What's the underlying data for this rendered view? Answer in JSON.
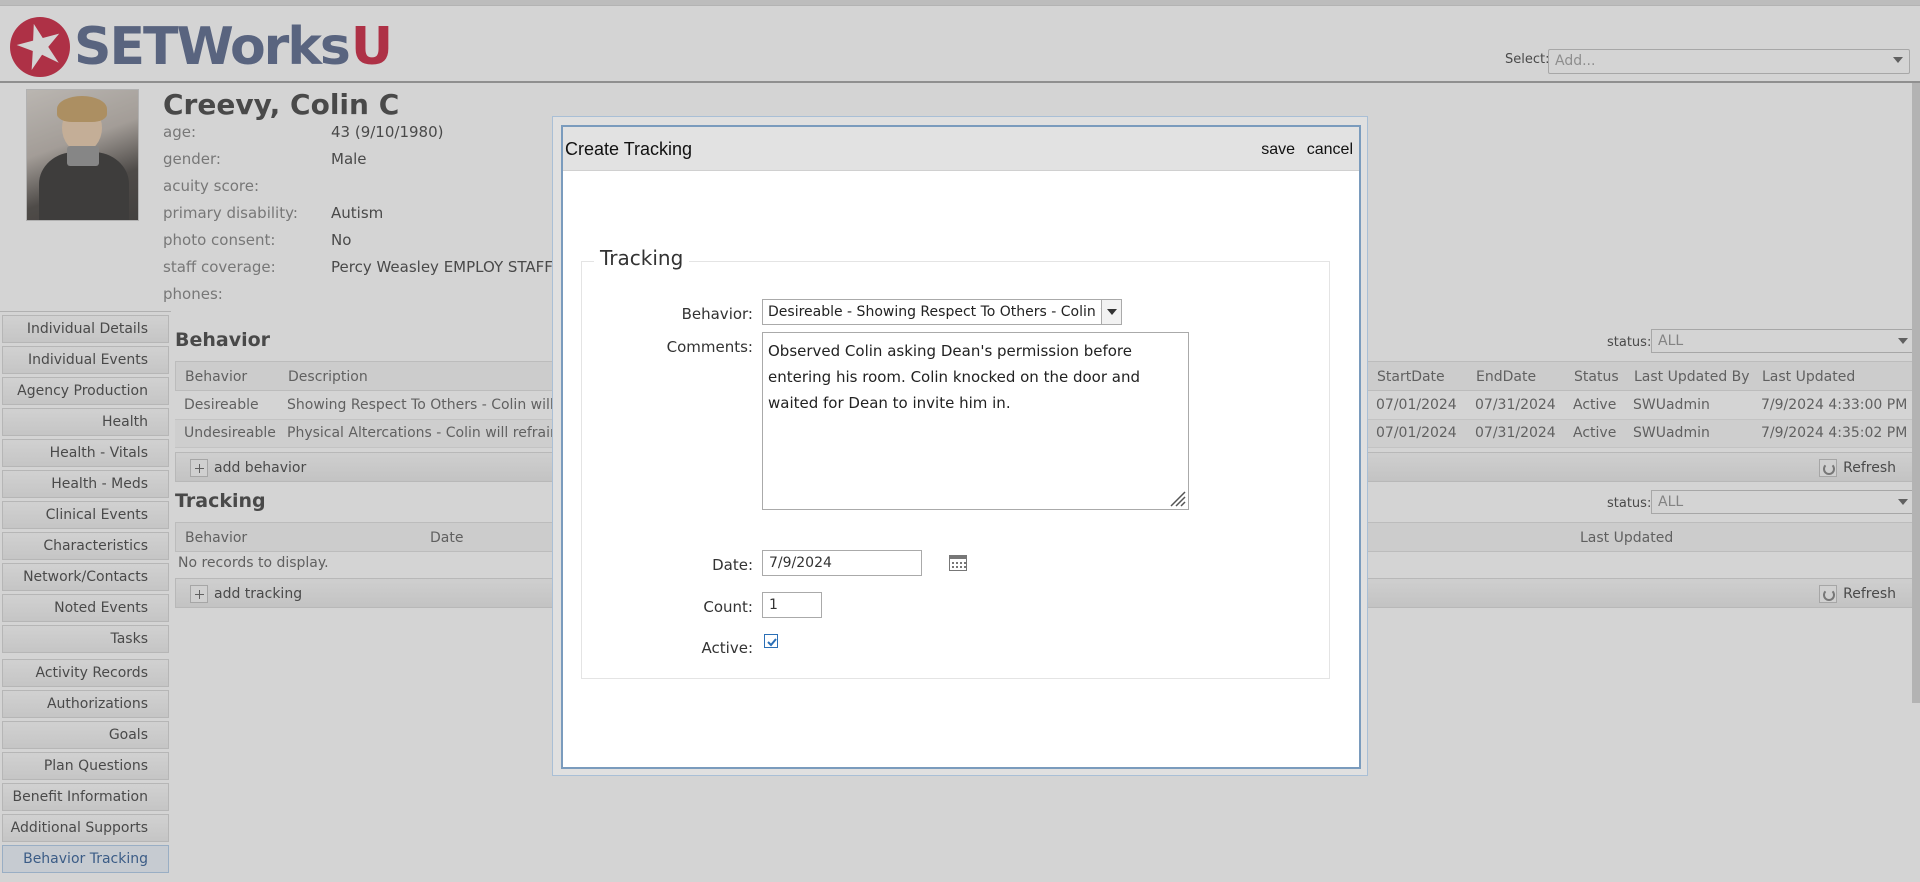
{
  "header": {
    "logo_text": "SETWorks",
    "logo_u": "U",
    "select_label": "Select:",
    "select_value": "Add..."
  },
  "profile": {
    "name": "Creevy, Colin C",
    "fields": [
      {
        "label": "age:",
        "value": "43 (9/10/1980)"
      },
      {
        "label": "gender:",
        "value": "Male"
      },
      {
        "label": "acuity score:",
        "value": ""
      },
      {
        "label": "primary disability:",
        "value": "Autism"
      },
      {
        "label": "photo consent:",
        "value": "No"
      },
      {
        "label": "staff coverage:",
        "value": "Percy Weasley EMPLOY STAFF"
      },
      {
        "label": "phones:",
        "value": ""
      }
    ]
  },
  "sidebar": {
    "items": [
      {
        "label": "Individual Details"
      },
      {
        "label": "Individual Events"
      },
      {
        "label": "Agency Production"
      },
      {
        "label": "Health"
      },
      {
        "label": "Health - Vitals"
      },
      {
        "label": "Health - Meds"
      },
      {
        "label": "Clinical Events"
      },
      {
        "label": "Characteristics"
      },
      {
        "label": "Network/Contacts"
      },
      {
        "label": "Noted Events"
      },
      {
        "label": "Tasks"
      },
      {
        "label": "Activity Records"
      },
      {
        "label": "Authorizations"
      },
      {
        "label": "Goals"
      },
      {
        "label": "Plan Questions"
      },
      {
        "label": "Benefit Information"
      },
      {
        "label": "Additional Supports"
      },
      {
        "label": "Behavior Tracking",
        "active": true
      }
    ]
  },
  "behavior_section": {
    "title": "Behavior",
    "status_label": "status:",
    "status_value": "ALL",
    "columns": [
      "Behavior",
      "Description",
      "StartDate",
      "EndDate",
      "Status",
      "Last Updated By",
      "Last Updated"
    ],
    "rows": [
      {
        "behavior": "Desireable",
        "description": "Showing Respect To Others - Colin will exhib",
        "start": "07/01/2024",
        "end": "07/31/2024",
        "status": "Active",
        "updated_by": "SWUadmin",
        "updated": "7/9/2024 4:33:00 PM"
      },
      {
        "behavior": "Undesireable",
        "description": "Physical Altercations - Colin will refrain from",
        "start": "07/01/2024",
        "end": "07/31/2024",
        "status": "Active",
        "updated_by": "SWUadmin",
        "updated": "7/9/2024 4:35:02 PM"
      }
    ],
    "add_label": "add behavior",
    "refresh_label": "Refresh"
  },
  "tracking_section": {
    "title": "Tracking",
    "status_label": "status:",
    "status_value": "ALL",
    "columns": [
      "Behavior",
      "Date",
      "Last Updated"
    ],
    "empty_text": "No records to display.",
    "add_label": "add tracking",
    "refresh_label": "Refresh"
  },
  "modal": {
    "title": "Create Tracking",
    "save_label": "save",
    "cancel_label": "cancel",
    "legend": "Tracking",
    "behavior_label": "Behavior:",
    "behavior_value": "Desireable - Showing Respect To Others - Colin will",
    "comments_label": "Comments:",
    "comments_value": "Observed Colin asking Dean's permission before entering his room. Colin knocked on the door and waited for Dean to invite him in.",
    "date_label": "Date:",
    "date_value": "7/9/2024",
    "count_label": "Count:",
    "count_value": "1",
    "active_label": "Active:",
    "active_checked": true
  },
  "colors": {
    "brand_blue": "#4a5a82",
    "brand_red": "#c8102e",
    "modal_border": "#7a9bbd",
    "check_blue": "#2b6fb6"
  }
}
